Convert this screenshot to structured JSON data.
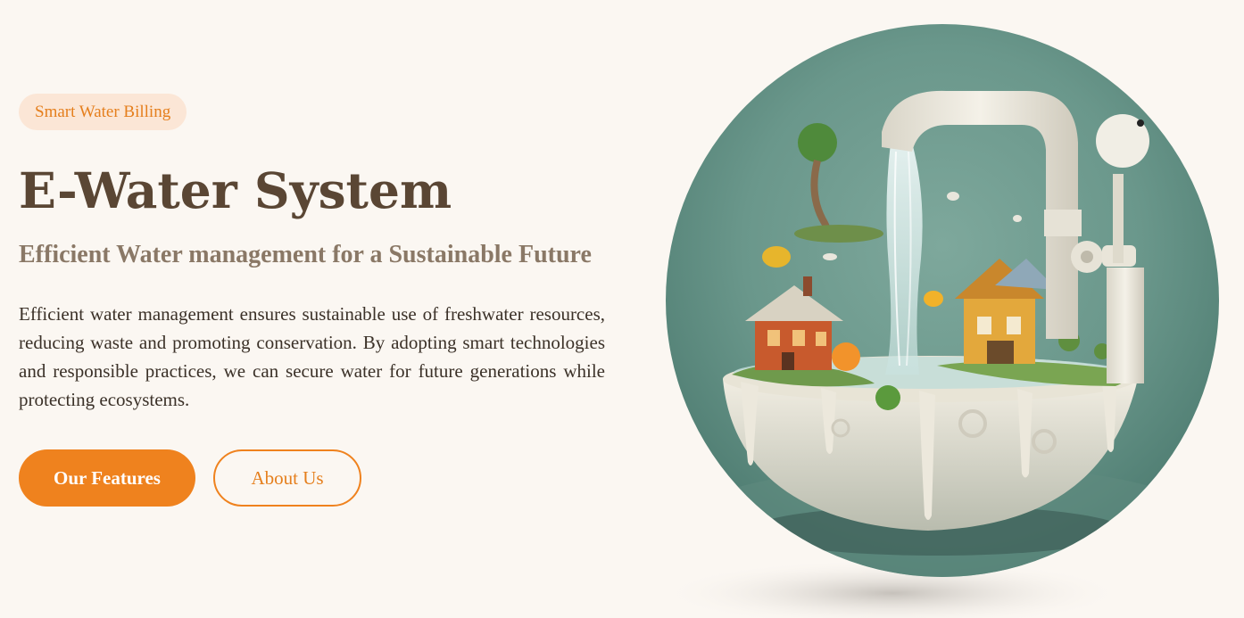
{
  "hero": {
    "badge": "Smart Water Billing",
    "title": "E-Water System",
    "subtitle": "Efficient Water management for a Sustainable Future",
    "description": "Efficient water management ensures sustainable use of freshwater resources, reducing waste and promoting conservation. By adopting smart technologies and responsible practices, we can secure water for future generations while protecting ecosystems.",
    "primary_button": "Our Features",
    "secondary_button": "About Us"
  },
  "colors": {
    "background": "#fbf7f2",
    "accent": "#ef821e",
    "badge_bg": "#fbe6d6",
    "title": "#5a4634",
    "subtitle": "#8a7866",
    "body_text": "#3b3128",
    "image_teal": "#6d9a8f"
  },
  "illustration": {
    "subject": "faucet-pouring-water-into-sink-with-miniature-houses-and-trees-image"
  }
}
